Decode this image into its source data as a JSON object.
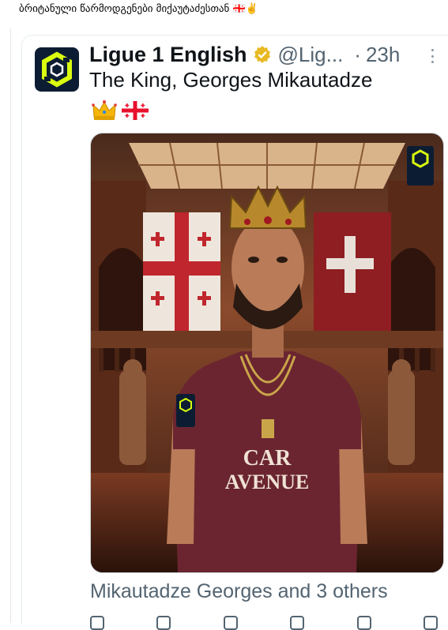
{
  "post_caption": "ბრიტანული წარმოდგენები მიქაუტაძესთან 🇬🇪✌️",
  "tweet": {
    "author_name": "Ligue 1 English",
    "handle": "@Lig...",
    "separator": "·",
    "time": "23h",
    "text": "The King, Georges Mikautadze",
    "emojis": [
      "crown-emoji",
      "georgia-flag-emoji"
    ],
    "media_title": "Mikautadze Georges and 3 others"
  },
  "icons": {
    "avatar": "ligue1-logo-icon",
    "verified": "verified-badge-icon",
    "more": "more-options-icon"
  },
  "colors": {
    "avatar_bg": "#0c1d33",
    "ligue1_green": "#dafd0f",
    "verified_gold": "#e8b923",
    "jersey": "#6b2530"
  }
}
